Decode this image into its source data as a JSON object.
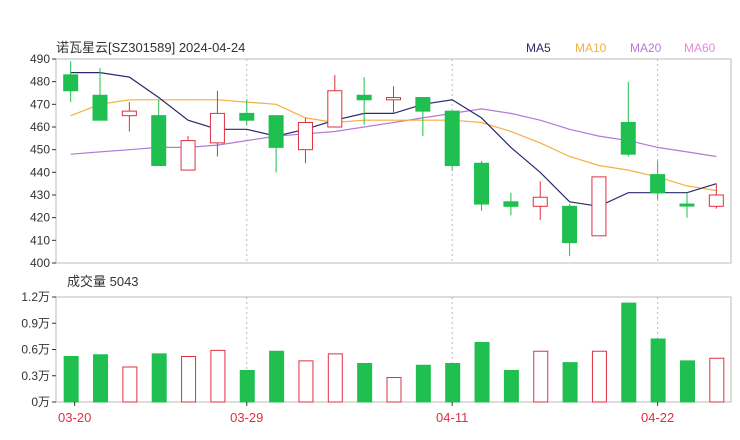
{
  "header": {
    "title": "诺瓦星云[SZ301589] 2024-04-24"
  },
  "legend": [
    {
      "key": "ma5",
      "label": "MA5",
      "color": "#2a2a6e"
    },
    {
      "key": "ma10",
      "label": "MA10",
      "color": "#f5b041"
    },
    {
      "key": "ma20",
      "label": "MA20",
      "color": "#b27bd6"
    },
    {
      "key": "ma60",
      "label": "MA60",
      "color": "#e48ad8"
    }
  ],
  "volume_header": {
    "label": "成交量 5043"
  },
  "colors": {
    "up": "#e03040",
    "down": "#1fbf50",
    "grid": "#bbbbbb",
    "axis": "#333333",
    "date": "#e03040"
  },
  "chart_data": [
    {
      "type": "candlestick",
      "y_ticks": [
        "490",
        "480",
        "470",
        "460",
        "450",
        "440",
        "430",
        "420",
        "410",
        "400"
      ],
      "ylim": [
        400,
        490
      ],
      "x_labels": [
        {
          "index": 0,
          "label": "03-20"
        },
        {
          "index": 7,
          "label": "03-29"
        },
        {
          "index": 14,
          "label": "04-11"
        },
        {
          "index": 21,
          "label": "04-22"
        }
      ],
      "candles": [
        {
          "o": 483,
          "c": 476,
          "h": 489,
          "l": 471,
          "dir": "down"
        },
        {
          "o": 474,
          "c": 463,
          "h": 486,
          "l": 463,
          "dir": "down"
        },
        {
          "o": 465,
          "c": 467,
          "h": 471,
          "l": 458,
          "dir": "up"
        },
        {
          "o": 465,
          "c": 443,
          "h": 472,
          "l": 443,
          "dir": "down"
        },
        {
          "o": 441,
          "c": 454,
          "h": 456,
          "l": 441,
          "dir": "up"
        },
        {
          "o": 453,
          "c": 466,
          "h": 476,
          "l": 447,
          "dir": "up"
        },
        {
          "o": 466,
          "c": 463,
          "h": 472,
          "l": 461,
          "dir": "down"
        },
        {
          "o": 465,
          "c": 451,
          "h": 465,
          "l": 440,
          "dir": "down"
        },
        {
          "o": 450,
          "c": 462,
          "h": 464,
          "l": 444,
          "dir": "up"
        },
        {
          "o": 460,
          "c": 476,
          "h": 483,
          "l": 460,
          "dir": "up"
        },
        {
          "o": 474,
          "c": 472,
          "h": 482,
          "l": 461,
          "dir": "down"
        },
        {
          "o": 472,
          "c": 473,
          "h": 478,
          "l": 466,
          "dir": "up"
        },
        {
          "o": 473,
          "c": 467,
          "h": 473,
          "l": 456,
          "dir": "down"
        },
        {
          "o": 467,
          "c": 443,
          "h": 467,
          "l": 441,
          "dir": "down"
        },
        {
          "o": 444,
          "c": 426,
          "h": 445,
          "l": 423,
          "dir": "down"
        },
        {
          "o": 427,
          "c": 425,
          "h": 431,
          "l": 421,
          "dir": "down"
        },
        {
          "o": 425,
          "c": 429,
          "h": 436,
          "l": 419,
          "dir": "up"
        },
        {
          "o": 425,
          "c": 409,
          "h": 426,
          "l": 403,
          "dir": "down"
        },
        {
          "o": 412,
          "c": 438,
          "h": 438,
          "l": 412,
          "dir": "up"
        },
        {
          "o": 462,
          "c": 448,
          "h": 480,
          "l": 447,
          "dir": "down"
        },
        {
          "o": 439,
          "c": 431,
          "h": 445,
          "l": 428,
          "dir": "down"
        },
        {
          "o": 426,
          "c": 426,
          "h": 431,
          "l": 420,
          "dir": "down"
        },
        {
          "o": 425,
          "c": 430,
          "h": 435,
          "l": 424,
          "dir": "up"
        }
      ],
      "ma5": [
        484,
        484,
        482,
        473,
        463,
        459,
        459,
        456,
        459,
        463,
        466,
        466,
        470,
        472,
        464,
        451,
        440,
        427,
        425,
        431,
        431,
        431,
        435
      ],
      "ma10": [
        465,
        470,
        472,
        472,
        472,
        472,
        471,
        470,
        464,
        462,
        463,
        463,
        463,
        463,
        462,
        458,
        453,
        447,
        443,
        441,
        438,
        434,
        432
      ],
      "ma20": [
        448,
        449,
        450,
        451,
        451,
        452,
        454,
        456,
        457,
        458,
        460,
        462,
        464,
        466,
        468,
        466,
        463,
        459,
        456,
        454,
        451,
        449,
        447
      ],
      "ma60": []
    },
    {
      "type": "bar",
      "y_ticks": [
        "1.2万",
        "0.9万",
        "0.6万",
        "0.3万",
        "0万"
      ],
      "ylim": [
        0,
        1.2
      ],
      "values": [
        0.52,
        0.54,
        0.4,
        0.55,
        0.52,
        0.59,
        0.36,
        0.58,
        0.47,
        0.55,
        0.44,
        0.28,
        0.42,
        0.44,
        0.68,
        0.36,
        0.58,
        0.45,
        0.58,
        1.13,
        0.72,
        0.47,
        0.5
      ],
      "dirs": [
        "down",
        "down",
        "up",
        "down",
        "up",
        "up",
        "down",
        "down",
        "up",
        "up",
        "down",
        "up",
        "down",
        "down",
        "down",
        "down",
        "up",
        "down",
        "up",
        "down",
        "down",
        "down",
        "up"
      ]
    }
  ]
}
